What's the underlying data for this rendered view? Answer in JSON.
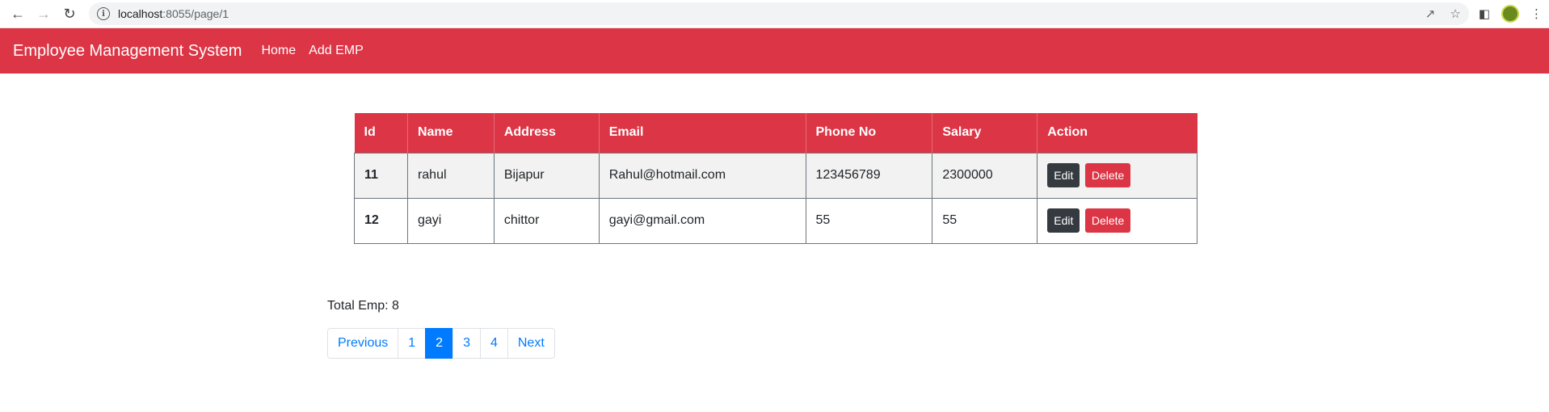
{
  "browser": {
    "url_host": "localhost",
    "url_path": ":8055/page/1"
  },
  "navbar": {
    "brand": "Employee Management System",
    "links": [
      "Home",
      "Add EMP"
    ]
  },
  "table": {
    "headers": [
      "Id",
      "Name",
      "Address",
      "Email",
      "Phone No",
      "Salary",
      "Action"
    ],
    "rows": [
      {
        "id": "11",
        "name": "rahul",
        "address": "Bijapur",
        "email": "Rahul@hotmail.com",
        "phone": "123456789",
        "salary": "2300000"
      },
      {
        "id": "12",
        "name": "gayi",
        "address": "chittor",
        "email": "gayi@gmail.com",
        "phone": "55",
        "salary": "55"
      }
    ],
    "edit_label": "Edit",
    "delete_label": "Delete"
  },
  "footer": {
    "total_text": "Total Emp: 8"
  },
  "pagination": {
    "previous": "Previous",
    "pages": [
      "1",
      "2",
      "3",
      "4"
    ],
    "active_page": "2",
    "next": "Next"
  },
  "colors": {
    "primary": "#dc3545",
    "link": "#007bff",
    "dark": "#343a40"
  }
}
